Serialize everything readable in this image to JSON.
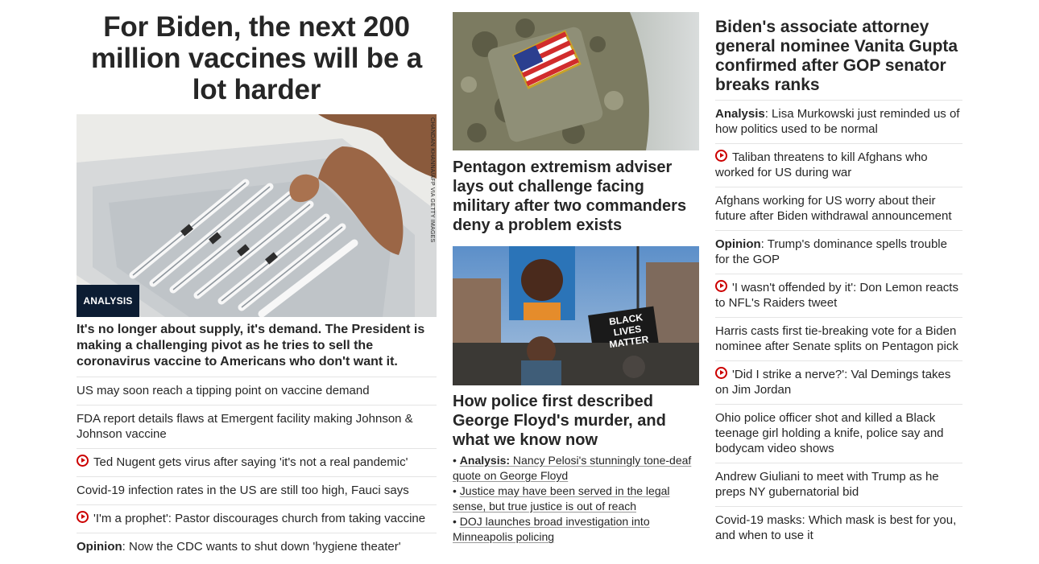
{
  "col1": {
    "headline": "For Biden, the next 200 million vaccines will be a lot harder",
    "badge": "ANALYSIS",
    "photo_credit": "CHANDAN KHANNA/AFP VIA GETTY IMAGES",
    "sub_headline": "It's no longer about supply, it's demand. The President is making a challenging pivot as he tries to sell the coronavirus vaccine to Americans who don't want it.",
    "items": [
      {
        "prefix": "",
        "text": "US may soon reach a tipping point on vaccine demand",
        "video": false
      },
      {
        "prefix": "",
        "text": "FDA report details flaws at Emergent facility making Johnson & Johnson vaccine",
        "video": false
      },
      {
        "prefix": "",
        "text": "Ted Nugent gets virus after saying 'it's not a real pandemic'",
        "video": true
      },
      {
        "prefix": "",
        "text": "Covid-19 infection rates in the US are still too high, Fauci says",
        "video": false
      },
      {
        "prefix": "",
        "text": "'I'm a prophet': Pastor discourages church from taking vaccine",
        "video": true
      },
      {
        "prefix": "Opinion",
        "text": ": Now the CDC wants to shut down 'hygiene theater'",
        "video": false
      }
    ]
  },
  "col2": {
    "headline1": "Pentagon extremism adviser lays out challenge facing military after two commanders deny a problem exists",
    "sign_text": "BLACK LIVES MATTER",
    "headline2": "How police first described George Floyd's murder, and what we know now",
    "bullets": [
      {
        "prefix": "Analysis:",
        "text": " Nancy Pelosi's stunningly tone-deaf quote on George Floyd"
      },
      {
        "prefix": "",
        "text": "Justice may have been served in the legal sense, but true justice is out of reach"
      },
      {
        "prefix": "",
        "text": "DOJ launches broad investigation into Minneapolis policing"
      }
    ]
  },
  "col3": {
    "headline": "Biden's associate attorney general nominee Vanita Gupta confirmed after GOP senator breaks ranks",
    "items": [
      {
        "prefix": "Analysis",
        "text": ": Lisa Murkowski just reminded us of how politics used to be normal",
        "video": false
      },
      {
        "prefix": "",
        "text": "Taliban threatens to kill Afghans who worked for US during war",
        "video": true
      },
      {
        "prefix": "",
        "text": "Afghans working for US worry about their future after Biden withdrawal announcement",
        "video": false
      },
      {
        "prefix": "Opinion",
        "text": ": Trump's dominance spells trouble for the GOP",
        "video": false
      },
      {
        "prefix": "",
        "text": "'I wasn't offended by it': Don Lemon reacts to NFL's Raiders tweet",
        "video": true
      },
      {
        "prefix": "",
        "text": "Harris casts first tie-breaking vote for a Biden nominee after Senate splits on Pentagon pick",
        "video": false
      },
      {
        "prefix": "",
        "text": "'Did I strike a nerve?': Val Demings takes on Jim Jordan",
        "video": true
      },
      {
        "prefix": "",
        "text": "Ohio police officer shot and killed a Black teenage girl holding a knife, police say and bodycam video shows",
        "video": false
      },
      {
        "prefix": "",
        "text": "Andrew Giuliani to meet with Trump as he preps NY gubernatorial bid",
        "video": false
      },
      {
        "prefix": "",
        "text": "Covid-19 masks: Which mask is best for you, and when to use it",
        "video": false
      }
    ]
  },
  "colors": {
    "text": "#262626",
    "video_red": "#cc0000",
    "badge_bg": "#0c1d33",
    "divider": "#e4e4e4"
  }
}
